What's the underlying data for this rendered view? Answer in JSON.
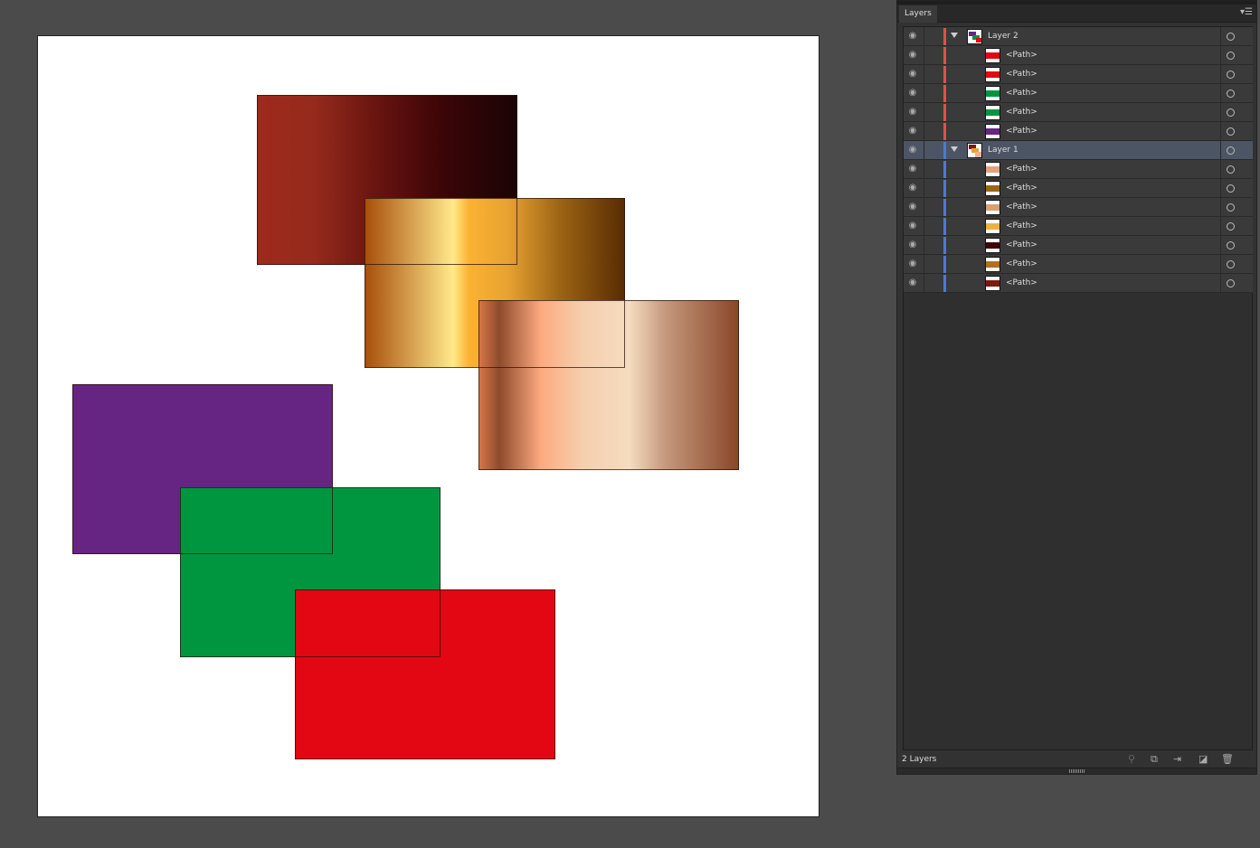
{
  "panel": {
    "tab": "Layers",
    "footer_count": "2 Layers"
  },
  "layers": [
    {
      "name": "Layer 2",
      "color": "#e05050",
      "selected": false,
      "children": [
        {
          "name": "<Path>",
          "thumb": "#e30613"
        },
        {
          "name": "<Path>",
          "thumb": "#e30613"
        },
        {
          "name": "<Path>",
          "thumb": "#009640"
        },
        {
          "name": "<Path>",
          "thumb": "#009640"
        },
        {
          "name": "<Path>",
          "thumb": "#662483"
        }
      ]
    },
    {
      "name": "Layer 1",
      "color": "#4a78e0",
      "selected": true,
      "children": [
        {
          "name": "<Path>",
          "thumb": "#e8a07a"
        },
        {
          "name": "<Path>",
          "thumb": "#9c6414"
        },
        {
          "name": "<Path>",
          "thumb": "#d9a070"
        },
        {
          "name": "<Path>",
          "thumb": "#f0b040"
        },
        {
          "name": "<Path>",
          "thumb": "#3d0507"
        },
        {
          "name": "<Path>",
          "thumb": "#b07020"
        },
        {
          "name": "<Path>",
          "thumb": "#7a1a10"
        }
      ]
    }
  ],
  "colors": {
    "purple": "#662483",
    "green": "#009640",
    "red": "#e30613"
  }
}
